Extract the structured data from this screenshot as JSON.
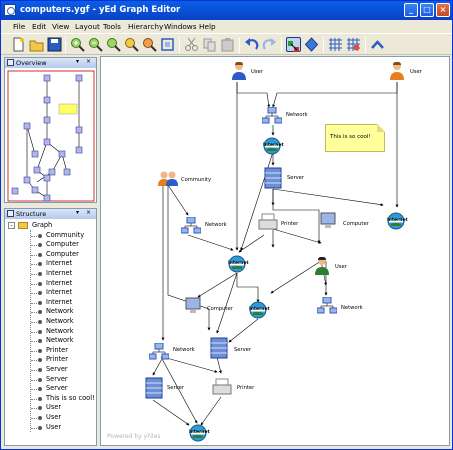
{
  "window": {
    "title": "computers.ygf - yEd Graph Editor",
    "controls": [
      "_",
      "□",
      "×"
    ]
  },
  "menu": [
    "File",
    "Edit",
    "View",
    "Layout",
    "Tools",
    "Hierarchy",
    "Windows",
    "Help"
  ],
  "toolbar": {
    "buttons": [
      "new-icon",
      "open-icon",
      "save-icon",
      "zoom-in-icon",
      "zoom-out-icon",
      "zoom-fit-icon",
      "zoom-area-icon",
      "zoom-selection-icon",
      "fit-content-icon",
      "cut-icon",
      "copy-icon",
      "paste-icon",
      "undo-icon",
      "redo-icon",
      "select-mode-icon",
      "move-mode-icon",
      "grid-icon",
      "snap-grid-icon",
      "collapse-icon"
    ]
  },
  "overview": {
    "title": "Overview"
  },
  "structure": {
    "title": "Structure",
    "root": "Graph",
    "items": [
      "Community",
      "Computer",
      "Computer",
      "Internet",
      "Internet",
      "Internet",
      "Internet",
      "Internet",
      "Network",
      "Network",
      "Network",
      "Network",
      "Printer",
      "Printer",
      "Server",
      "Server",
      "Server",
      "This is so cool!",
      "User",
      "User",
      "User"
    ]
  },
  "graph": {
    "labels": {
      "user1": "User",
      "user2": "User",
      "network1": "Network",
      "note": "This is so cool!",
      "internet1": "Internet",
      "server1": "Server",
      "community": "Community",
      "network2": "Network",
      "printer1": "Printer",
      "computer1": "Computer",
      "internet2": "Internet",
      "internet3": "Internet",
      "user3": "User",
      "computer2": "Computer",
      "internet4": "Internet",
      "network3": "Network",
      "network4": "Network",
      "server2": "Server",
      "server3": "Server",
      "printer2": "Printer",
      "internet5": "Internet"
    },
    "watermark": "Powered by yFiles"
  },
  "colors": {
    "titlebar": "#0a5fe7",
    "accent": "#316ac5",
    "note": "#ffff9c",
    "internet": "#2e7d32",
    "user": "#e67e22"
  }
}
